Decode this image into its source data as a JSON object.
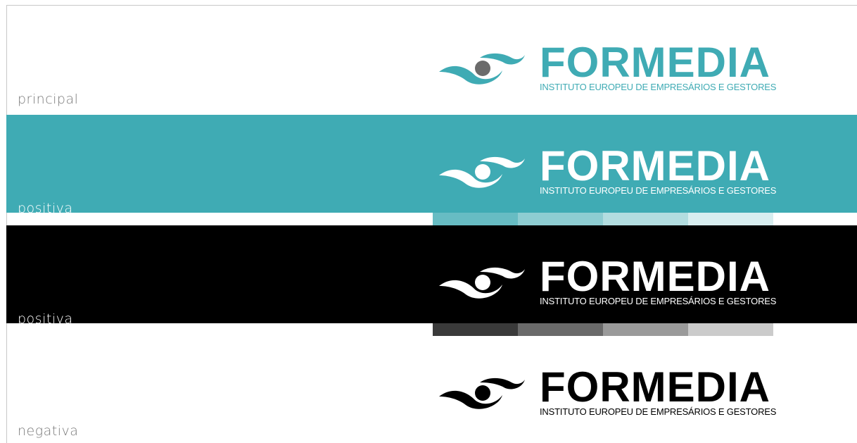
{
  "logo": {
    "name": "FORMEDIA",
    "tagline": "INSTITUTO EUROPEU DE EMPRESÁRIOS E GESTORES"
  },
  "variants": [
    {
      "label": "principal",
      "background": "#ffffff",
      "text_color": "#7a7a7a",
      "logo_color": "#3fabb4",
      "pupil_color": "#6b6b6b"
    },
    {
      "label": "positiva",
      "background": "#3fabb4",
      "text_color": "#ffffff",
      "logo_color": "#ffffff",
      "pupil_color": "#ffffff"
    },
    {
      "label": "positiva",
      "background": "#000000",
      "text_color": "#ffffff",
      "logo_color": "#ffffff",
      "pupil_color": "#ffffff"
    },
    {
      "label": "negativa",
      "background": "#ffffff",
      "text_color": "#7a7a7a",
      "logo_color": "#000000",
      "pupil_color": "#000000"
    }
  ],
  "swatch_sets": {
    "teal": [
      "#67bcc3",
      "#8ecdd2",
      "#b3dde0",
      "#d8eef0"
    ],
    "gray": [
      "#3a3a3a",
      "#6a6a6a",
      "#9a9a9a",
      "#cbcbcb"
    ]
  }
}
